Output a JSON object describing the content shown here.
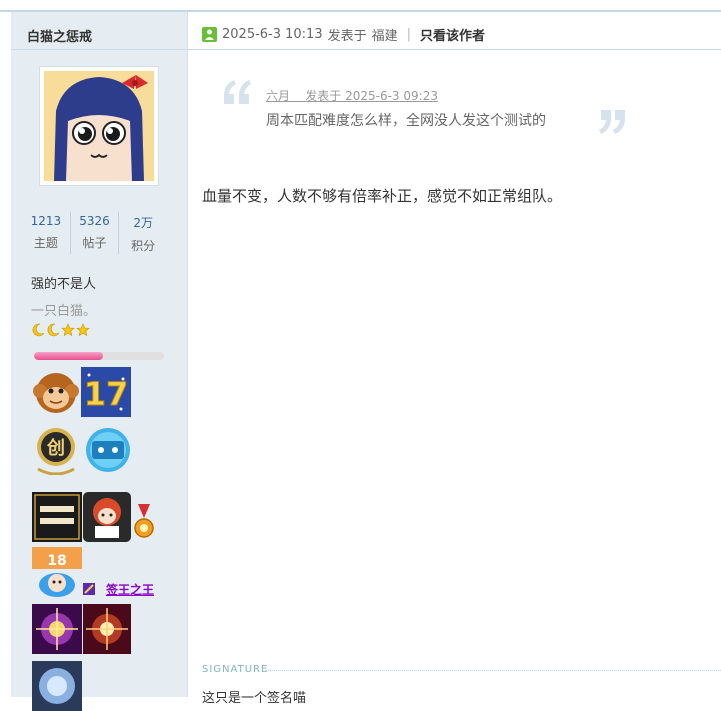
{
  "author": {
    "name": "白猫之惩戒",
    "stats": [
      {
        "value": "1213",
        "label": "主题"
      },
      {
        "value": "5326",
        "label": "帖子"
      },
      {
        "value": "2万",
        "label": "积分"
      }
    ],
    "rank": "强的不是人",
    "title": "一只白猫。",
    "star_icons": [
      "moon-icon",
      "moon-icon",
      "star-icon",
      "star-icon"
    ],
    "level_progress": 0.53,
    "medal_label": "签王之王"
  },
  "post": {
    "timestamp": "2025-6-3 10:13",
    "posted_in": "发表于",
    "location": "福建",
    "author_only": "只看该作者",
    "quote": {
      "author": "六月",
      "meta": "发表于 2025-6-3 09:23",
      "text": "周本匹配难度怎么样，全网没人发这个测试的"
    },
    "message": "血量不变，人数不够有倍率补正，感觉不如正常组队。",
    "signature_label": "SIGNATURE",
    "signature_text": "这只是一个签名喵"
  },
  "colors": {
    "sidebar_bg": "#e5edf2",
    "link": "#336699",
    "progress": "#e8508e",
    "medal_text": "#8a00c8"
  }
}
